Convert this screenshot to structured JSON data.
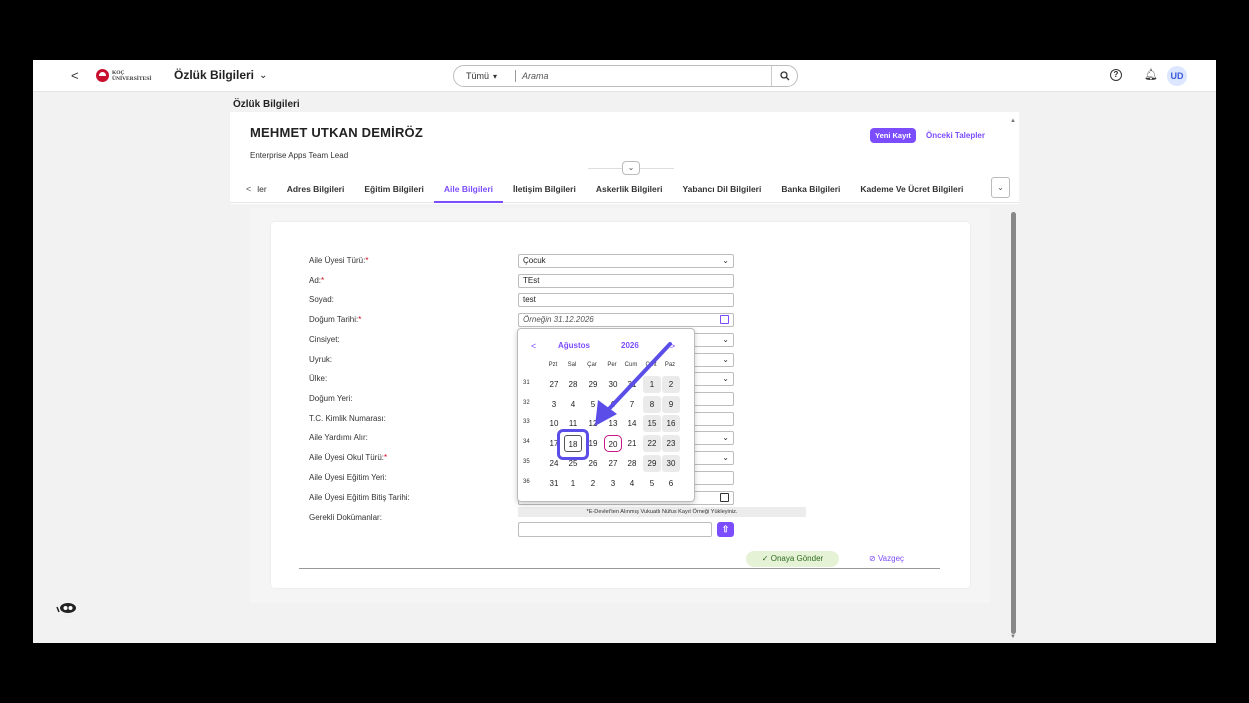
{
  "topbar": {
    "back": "<",
    "logo_line1": "KOÇ",
    "logo_line2": "ÜNİVERSİTESİ",
    "app_title": "Özlük Bilgileri",
    "search_scope": "Tümü",
    "search_placeholder": "Arama",
    "avatar": "UD"
  },
  "page_label": "Özlük Bilgileri",
  "employee": {
    "name": "MEHMET UTKAN DEMİRÖZ",
    "role": "Enterprise Apps Team Lead"
  },
  "actions": {
    "new_record": "Yeni Kayıt",
    "previous_requests": "Önceki Talepler"
  },
  "tabs": [
    {
      "label": "ler"
    },
    {
      "label": "Adres Bilgileri"
    },
    {
      "label": "Eğitim Bilgileri"
    },
    {
      "label": "Aile Bilgileri",
      "active": true
    },
    {
      "label": "İletişim Bilgileri"
    },
    {
      "label": "Askerlik Bilgileri"
    },
    {
      "label": "Yabancı Dil Bilgileri"
    },
    {
      "label": "Banka Bilgileri"
    },
    {
      "label": "Kademe Ve Ücret Bilgileri"
    }
  ],
  "form": {
    "labels": [
      "Aile Üyesi Türü:",
      "Ad:",
      "Soyad:",
      "Doğum Tarihi:",
      "Cinsiyet:",
      "Uyruk:",
      "Ülke:",
      "Doğum Yeri:",
      "T.C. Kimlik Numarası:",
      "Aile Yardımı Alır:",
      "Aile Üyesi Okul Türü:",
      "Aile Üyesi Eğitim Yeri:",
      "Aile Üyesi Eğitim Bitiş Tarihi:",
      "Gerekli Dokümanlar:"
    ],
    "required_mark": "*",
    "aile_uyesi_turu": "Çocuk",
    "ad": "TEst",
    "soyad": "test",
    "dogum_tarihi_placeholder": "Örneğin 31.12.2026",
    "note": "*E-Devlet'ten Alınmış Vukuatlı Nüfus Kayıt Örneği Yükleyiniz.",
    "send": "Onaya Gönder",
    "cancel": "Vazgeç"
  },
  "calendar": {
    "month": "Ağustos",
    "year": "2026",
    "weekdays": [
      "Pzt",
      "Sal",
      "Çar",
      "Per",
      "Cum",
      "Cmt",
      "Paz"
    ],
    "weeks": [
      {
        "no": "31",
        "days": [
          "27",
          "28",
          "29",
          "30",
          "31",
          "1",
          "2"
        ]
      },
      {
        "no": "32",
        "days": [
          "3",
          "4",
          "5",
          "6",
          "7",
          "8",
          "9"
        ]
      },
      {
        "no": "33",
        "days": [
          "10",
          "11",
          "12",
          "13",
          "14",
          "15",
          "16"
        ]
      },
      {
        "no": "34",
        "days": [
          "17",
          "18",
          "19",
          "20",
          "21",
          "22",
          "23"
        ]
      },
      {
        "no": "35",
        "days": [
          "24",
          "25",
          "26",
          "27",
          "28",
          "29",
          "30"
        ]
      },
      {
        "no": "36",
        "days": [
          "31",
          "1",
          "2",
          "3",
          "4",
          "5",
          "6"
        ]
      }
    ],
    "selected_day": "18",
    "today_day": "20"
  },
  "colors": {
    "accent": "#7c4dff",
    "annotation": "#5b4ee8",
    "required": "#d0021b"
  }
}
